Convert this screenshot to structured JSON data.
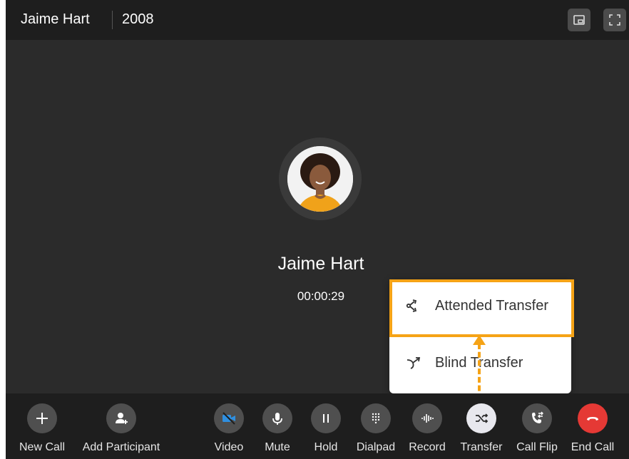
{
  "header": {
    "caller_name": "Jaime Hart",
    "extension": "2008"
  },
  "call": {
    "contact_name": "Jaime Hart",
    "duration": "00:00:29"
  },
  "transfer_menu": {
    "items": [
      {
        "label": "Attended Transfer",
        "icon": "attended-transfer-icon"
      },
      {
        "label": "Blind Transfer",
        "icon": "blind-transfer-icon"
      }
    ]
  },
  "controls": [
    {
      "label": "New Call",
      "icon": "plus-icon"
    },
    {
      "label": "Add Participant",
      "icon": "add-participant-icon"
    },
    {
      "label": "Video",
      "icon": "video-off-icon"
    },
    {
      "label": "Mute",
      "icon": "microphone-icon"
    },
    {
      "label": "Hold",
      "icon": "pause-icon"
    },
    {
      "label": "Dialpad",
      "icon": "dialpad-icon"
    },
    {
      "label": "Record",
      "icon": "waveform-icon"
    },
    {
      "label": "Transfer",
      "icon": "shuffle-icon"
    },
    {
      "label": "Call Flip",
      "icon": "call-flip-icon"
    },
    {
      "label": "End Call",
      "icon": "hangup-icon"
    }
  ],
  "colors": {
    "highlight": "#f5a316",
    "end_call": "#e53935",
    "video": "#2f8fe0",
    "transfer_active": "#e8e8ee",
    "background": "#2b2b2b"
  }
}
